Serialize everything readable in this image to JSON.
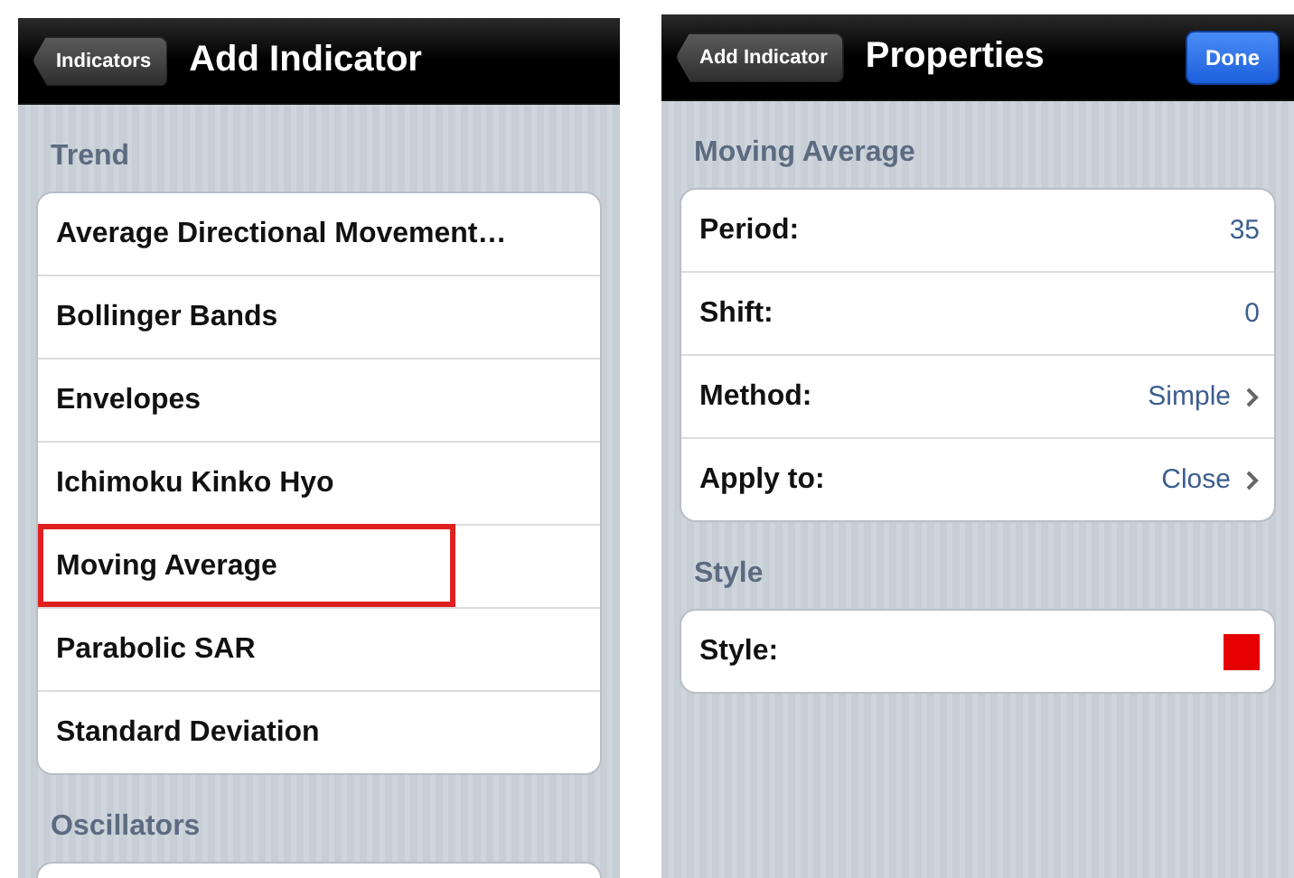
{
  "screens": [
    {
      "back_button": "Indicators",
      "title": "Add Indicator",
      "sections": [
        {
          "header": "Trend",
          "items": [
            {
              "label": "Average Directional Movement…",
              "highlighted": false
            },
            {
              "label": "Bollinger Bands",
              "highlighted": false
            },
            {
              "label": "Envelopes",
              "highlighted": false
            },
            {
              "label": "Ichimoku Kinko Hyo",
              "highlighted": false
            },
            {
              "label": "Moving Average",
              "highlighted": true
            },
            {
              "label": "Parabolic SAR",
              "highlighted": false
            },
            {
              "label": "Standard Deviation",
              "highlighted": false
            }
          ]
        },
        {
          "header": "Oscillators"
        }
      ]
    },
    {
      "back_button": "Add Indicator",
      "title": "Properties",
      "done_button": "Done",
      "sections": [
        {
          "header": "Moving Average",
          "items": [
            {
              "kind": "value",
              "label": "Period:",
              "value": "35"
            },
            {
              "kind": "value",
              "label": "Shift:",
              "value": "0"
            },
            {
              "kind": "picker",
              "label": "Method:",
              "value": "Simple"
            },
            {
              "kind": "picker",
              "label": "Apply to:",
              "value": "Close"
            }
          ]
        },
        {
          "header": "Style",
          "items": [
            {
              "kind": "color",
              "label": "Style:",
              "color": "#e60000"
            }
          ]
        }
      ]
    }
  ]
}
